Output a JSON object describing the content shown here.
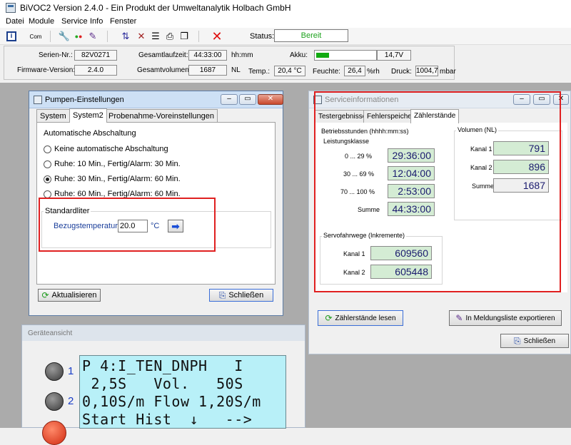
{
  "app": {
    "title": "BiVOC2 Version 2.4.0 - Ein Produkt der Umweltanalytik Holbach GmbH"
  },
  "menu": [
    "Datei",
    "Module",
    "Service",
    "Info",
    "Fenster"
  ],
  "toolbar": {
    "com_label": "Com",
    "status_label": "Status:",
    "status_value": "Bereit",
    "status_color": "#1ea21e"
  },
  "info": {
    "serial_label": "Serien-Nr.:",
    "serial_value": "82V0271",
    "firmware_label": "Firmware-Version:",
    "firmware_value": "2.4.0",
    "runtime_label": "Gesamtlaufzeit:",
    "runtime_value": "44:33:00",
    "runtime_unit": "hh:mm",
    "volume_label": "Gesamtvolumen:",
    "volume_value": "1687",
    "volume_unit": "NL",
    "akku_label": "Akku:",
    "akku_level_percent": 22,
    "akku_voltage": "14,7V",
    "temp_label": "Temp.:",
    "temp_value": "20,4 °C",
    "humidity_label": "Feuchte:",
    "humidity_value": "26,4",
    "humidity_unit": "%rh",
    "pressure_label": "Druck:",
    "pressure_value": "1004,7",
    "pressure_unit": "mbar"
  },
  "pump_window": {
    "title": "Pumpen-Einstellungen",
    "tabs": [
      "System",
      "System2",
      "Probenahme-Voreinstellungen"
    ],
    "active_tab": 1,
    "auto_off_title": "Automatische Abschaltung",
    "options": [
      {
        "label": "Keine automatische Abschaltung",
        "checked": false
      },
      {
        "label": "Ruhe: 10 Min., Fertig/Alarm: 30 Min.",
        "checked": false
      },
      {
        "label": "Ruhe: 30 Min., Fertig/Alarm: 60 Min.",
        "checked": true
      },
      {
        "label": "Ruhe: 60 Min., Fertig/Alarm: 60 Min.",
        "checked": false
      }
    ],
    "std_title": "Standardliter",
    "ref_temp_label": "Bezugstemperatur",
    "ref_temp_value": "20.0",
    "ref_temp_unit": "°C",
    "refresh_label": "Aktualisieren",
    "close_label": "Schließen"
  },
  "service_window": {
    "title": "Serviceinformationen",
    "tabs": [
      "Testergebnisse",
      "Fehlerspeicher",
      "Zählerstände"
    ],
    "active_tab": 2,
    "hours_title": "Betriebsstunden (hhhh:mm:ss)",
    "load_title": "Leistungsklasse",
    "hours_rows": [
      {
        "label": "0 ... 29 %",
        "value": "29:36:00"
      },
      {
        "label": "30 ... 69 %",
        "value": "12:04:00"
      },
      {
        "label": "70 ... 100 %",
        "value": "2:53:00"
      },
      {
        "label": "Summe",
        "value": "44:33:00"
      }
    ],
    "volume_title": "Volumen (NL)",
    "volume_rows": [
      {
        "label": "Kanal 1",
        "value": "791"
      },
      {
        "label": "Kanal 2",
        "value": "896"
      },
      {
        "label": "Summe",
        "value": "1687"
      }
    ],
    "servo_title": "Servofahrwege (Inkremente)",
    "servo_rows": [
      {
        "label": "Kanal 1",
        "value": "609560"
      },
      {
        "label": "Kanal 2",
        "value": "605448"
      }
    ],
    "read_label": "Zählerstände lesen",
    "export_label": "In Meldungsliste exportieren",
    "close_label": "Schließen"
  },
  "device_view": {
    "title": "Geräteansicht",
    "knob1": "1",
    "knob2": "2",
    "lcd": [
      "P 4:I_TEN_DNPH   I",
      " 2,5S   Vol.   50S",
      "0,10S/m Flow 1,20S/m",
      "Start Hist  ↓   -->"
    ]
  }
}
